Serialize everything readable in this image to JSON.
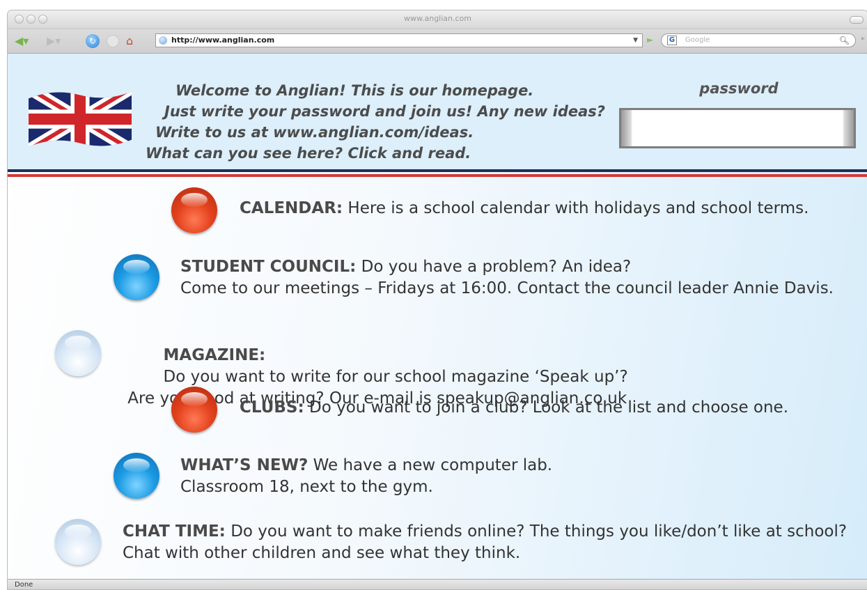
{
  "window": {
    "title": "www.anglian.com"
  },
  "toolbar": {
    "url": "http://www.anglian.com",
    "search_placeholder": "Google",
    "search_engine_letter": "G"
  },
  "header": {
    "welcome_lines": [
      "Welcome to Anglian! This is our homepage.",
      "Just write your password and join us! Any new ideas?",
      "Write to us at www.anglian.com/ideas.",
      "What can you see here? Click and read."
    ],
    "password_label": "password",
    "password_value": ""
  },
  "items": [
    {
      "bullet": "red",
      "title": "CALENDAR:",
      "line1": "Here is a school calendar with holidays and school terms.",
      "line2": ""
    },
    {
      "bullet": "blue",
      "title": "STUDENT COUNCIL:",
      "line1": "Do you have a problem? An idea?",
      "line2": "Come to our meetings – Fridays at 16:00. Contact the council leader Annie Davis."
    },
    {
      "bullet": "pale",
      "title": "MAGAZINE:",
      "line1": "Do you want to write for our school magazine ‘Speak up’?",
      "line2": " Are you good at writing? Our e-mail is speakup@anglian.co.uk"
    },
    {
      "bullet": "red",
      "title": "CLUBS:",
      "line1": "Do you want to join a club? Look at the list and choose one.",
      "line2": ""
    },
    {
      "bullet": "blue",
      "title": "WHAT’S NEW?",
      "line1": "We have a new computer lab.",
      "line2": "Classroom 18, next to the gym."
    },
    {
      "bullet": "pale",
      "title": "CHAT TIME:",
      "line1": "Do you want to make friends online? The things you like/don’t like at school?",
      "line2": "Chat with other children and see what they think."
    }
  ],
  "status": {
    "text": "Done"
  },
  "colors": {
    "header_bg": "#dceffb",
    "stripe_blue": "#1d2f5a",
    "stripe_red": "#d23a36",
    "bullet_red": "#e2411c",
    "bullet_blue": "#1c9be4",
    "bullet_pale": "#d6e6f6"
  }
}
